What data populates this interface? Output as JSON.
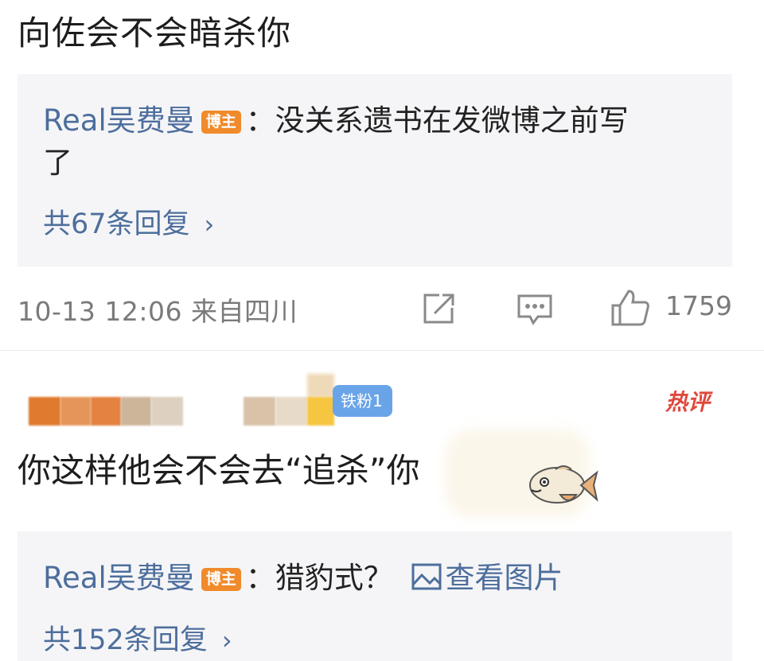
{
  "comment1": {
    "text": "向佐会不会暗杀你",
    "reply": {
      "user": "Real吴费曼",
      "badge": "博主",
      "separator": "：",
      "text_line1": "没关系遗书在发微博之前写",
      "text_line2": "了"
    },
    "more_replies": "共67条回复",
    "meta": "10-13 12:06 来自四川",
    "like_count": "1759"
  },
  "comment2": {
    "fan_badge": "铁粉1",
    "hot_tag": "热评",
    "text": "你这样他会不会去“追杀”你",
    "reply": {
      "user": "Real吴费曼",
      "badge": "博主",
      "separator": "：",
      "text": "猎豹式？",
      "view_image": "查看图片"
    },
    "more_replies": "共152条回复"
  },
  "colors": {
    "link": "#4d6e9c",
    "badge": "#f08a2b",
    "hot": "#e0493d",
    "fan_badge": "#6aa4e8"
  },
  "icons": [
    "share-icon",
    "comment-icon",
    "like-icon",
    "chevron-right-icon",
    "image-icon",
    "fish-sticker-icon"
  ]
}
